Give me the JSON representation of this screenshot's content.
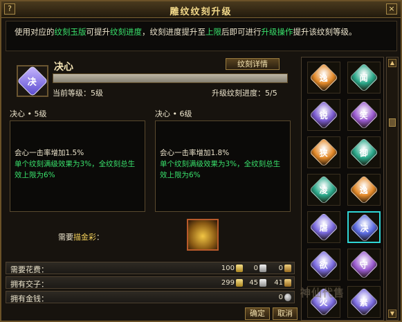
{
  "title": "雕纹纹刻升级",
  "title_icons": {
    "left": "?",
    "right": "×"
  },
  "description": {
    "p1": "使用对应的",
    "h1": "纹刻玉版",
    "p2": "可提升",
    "h2": "纹刻进度",
    "p3": "，纹刻进度提升至",
    "h3": "上限",
    "p4": "后即可进行",
    "h4": "升级操作",
    "p5": "提升该纹刻等级。"
  },
  "engraving": {
    "name": "决心",
    "gem_glyph": "决",
    "details_button": "纹刻详情",
    "current_level_label": "当前等级：5级",
    "progress_label": "升级纹刻进度：5/5",
    "progress_fraction": 1.0
  },
  "current_panel": {
    "header": "决心 • 5级",
    "line1": "会心一击率增加1.5%",
    "line2": "单个纹刻满级效果为3%，全纹刻总生效上限为6%"
  },
  "next_panel": {
    "header": "决心 • 6级",
    "line1": "会心一击率增加1.8%",
    "line2": "单个纹刻满级效果为3%，全纹刻总生效上限为6%"
  },
  "requirement": {
    "prefix": "需要",
    "item": "描金彩",
    "suffix": "："
  },
  "costs": {
    "label": "需要花费：",
    "gold": "100",
    "silver": "0",
    "copper": "0"
  },
  "owned_jiaozi": {
    "label": "拥有交子：",
    "gold": "299",
    "silver": "45",
    "copper": "41"
  },
  "owned_money": {
    "label": "拥有金钱：",
    "value": "0"
  },
  "buttons": {
    "confirm": "确定",
    "cancel": "取消"
  },
  "gem_grid": [
    {
      "glyph": "逸",
      "color": "#e48a2a"
    },
    {
      "glyph": "闻",
      "color": "#2aa88a"
    },
    {
      "glyph": "锐",
      "color": "#7a5ad0"
    },
    {
      "glyph": "笑",
      "color": "#9a5ad0"
    },
    {
      "glyph": "狭",
      "color": "#e48a2a"
    },
    {
      "glyph": "御",
      "color": "#2aa88a"
    },
    {
      "glyph": "凌",
      "color": "#2aa88a"
    },
    {
      "glyph": "逸",
      "color": "#e48a2a"
    },
    {
      "glyph": "虐",
      "color": "#7a6ae0"
    },
    {
      "glyph": "决",
      "color": "#5a6ae0"
    },
    {
      "glyph": "欲",
      "color": "#7a6ae0"
    },
    {
      "glyph": "守",
      "color": "#9a5ad0"
    },
    {
      "glyph": "火",
      "color": "#7a6ae0"
    },
    {
      "glyph": "素",
      "color": "#7a6ae0"
    }
  ],
  "selected_gem_index": 9,
  "watermark": "神仙代售"
}
